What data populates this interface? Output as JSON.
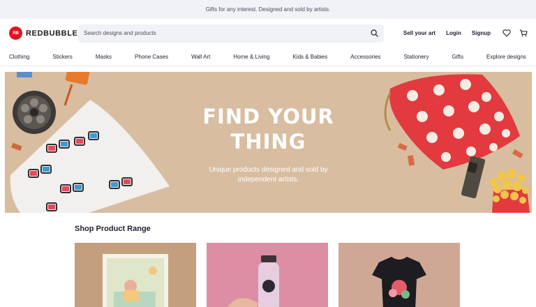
{
  "promo": {
    "text": "Gifts for any interest. Designed and sold by artists."
  },
  "header": {
    "logo_text": "REDBUBBLE",
    "logo_badge": "RB",
    "search_placeholder": "Search designs and products",
    "sell_label": "Sell your art",
    "login_label": "Login",
    "signup_label": "Signup",
    "icons": [
      "search-icon",
      "heart-icon",
      "cart-icon"
    ]
  },
  "nav": {
    "items": [
      {
        "label": "Clothing"
      },
      {
        "label": "Stickers"
      },
      {
        "label": "Masks"
      },
      {
        "label": "Phone Cases"
      },
      {
        "label": "Wall Art"
      },
      {
        "label": "Home & Living"
      },
      {
        "label": "Kids & Babies"
      },
      {
        "label": "Accessories"
      },
      {
        "label": "Stationery"
      },
      {
        "label": "Gifts"
      },
      {
        "label": "Explore designs"
      }
    ]
  },
  "hero": {
    "title": "FIND YOUR\nTHING",
    "subtitle": "Unique products designed and sold by\nindependent artists."
  },
  "shop": {
    "section_title": "Shop Product Range"
  },
  "colors": {
    "brand": "#e41321",
    "hero_bg": "#d8bda0",
    "promo_bg": "#f1f2f6",
    "pillow_red": "#e23a3f"
  }
}
